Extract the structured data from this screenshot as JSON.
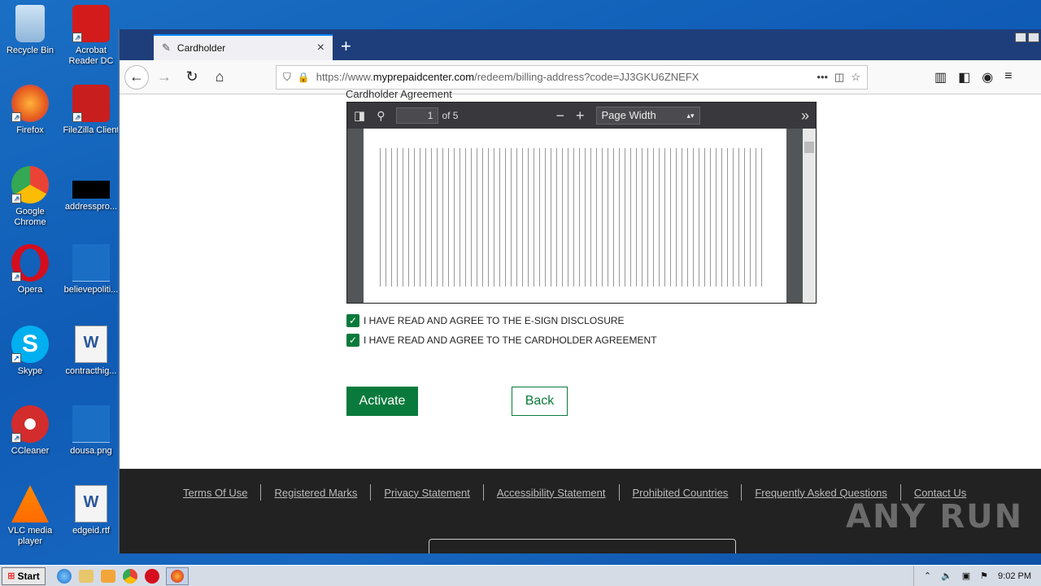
{
  "desktop": {
    "icons": [
      {
        "label": "Recycle Bin"
      },
      {
        "label": "Acrobat Reader DC"
      },
      {
        "label": "Firefox"
      },
      {
        "label": "FileZilla Client"
      },
      {
        "label": "Google Chrome"
      },
      {
        "label": "addresspro..."
      },
      {
        "label": "Opera"
      },
      {
        "label": "believepoliti..."
      },
      {
        "label": "Skype"
      },
      {
        "label": "contracthig..."
      },
      {
        "label": "CCleaner"
      },
      {
        "label": "dousa.png"
      },
      {
        "label": "VLC media player"
      },
      {
        "label": "edgeid.rtf"
      }
    ]
  },
  "browser": {
    "tab_title": "Cardholder",
    "url_prefix": "https://www.",
    "url_domain": "myprepaidcenter.com",
    "url_path": "/redeem/billing-address?code=JJ3GKU6ZNEFX"
  },
  "page": {
    "heading_cut": "Cardholder Agreement",
    "pdf": {
      "page_number": "1",
      "page_total": "of 5",
      "zoom": "Page Width"
    },
    "checkbox_esign": "I HAVE READ AND AGREE TO THE E-SIGN DISCLOSURE",
    "checkbox_cardholder": "I HAVE READ AND AGREE TO THE CARDHOLDER AGREEMENT",
    "activate_label": "Activate",
    "back_label": "Back"
  },
  "footer": {
    "links": [
      "Terms Of Use",
      "Registered Marks",
      "Privacy Statement",
      "Accessibility Statement",
      "Prohibited Countries",
      "Frequently Asked Questions",
      "Contact Us"
    ],
    "watermark": "ANY RUN"
  },
  "taskbar": {
    "start_label": "Start",
    "clock": "9:02 PM"
  }
}
